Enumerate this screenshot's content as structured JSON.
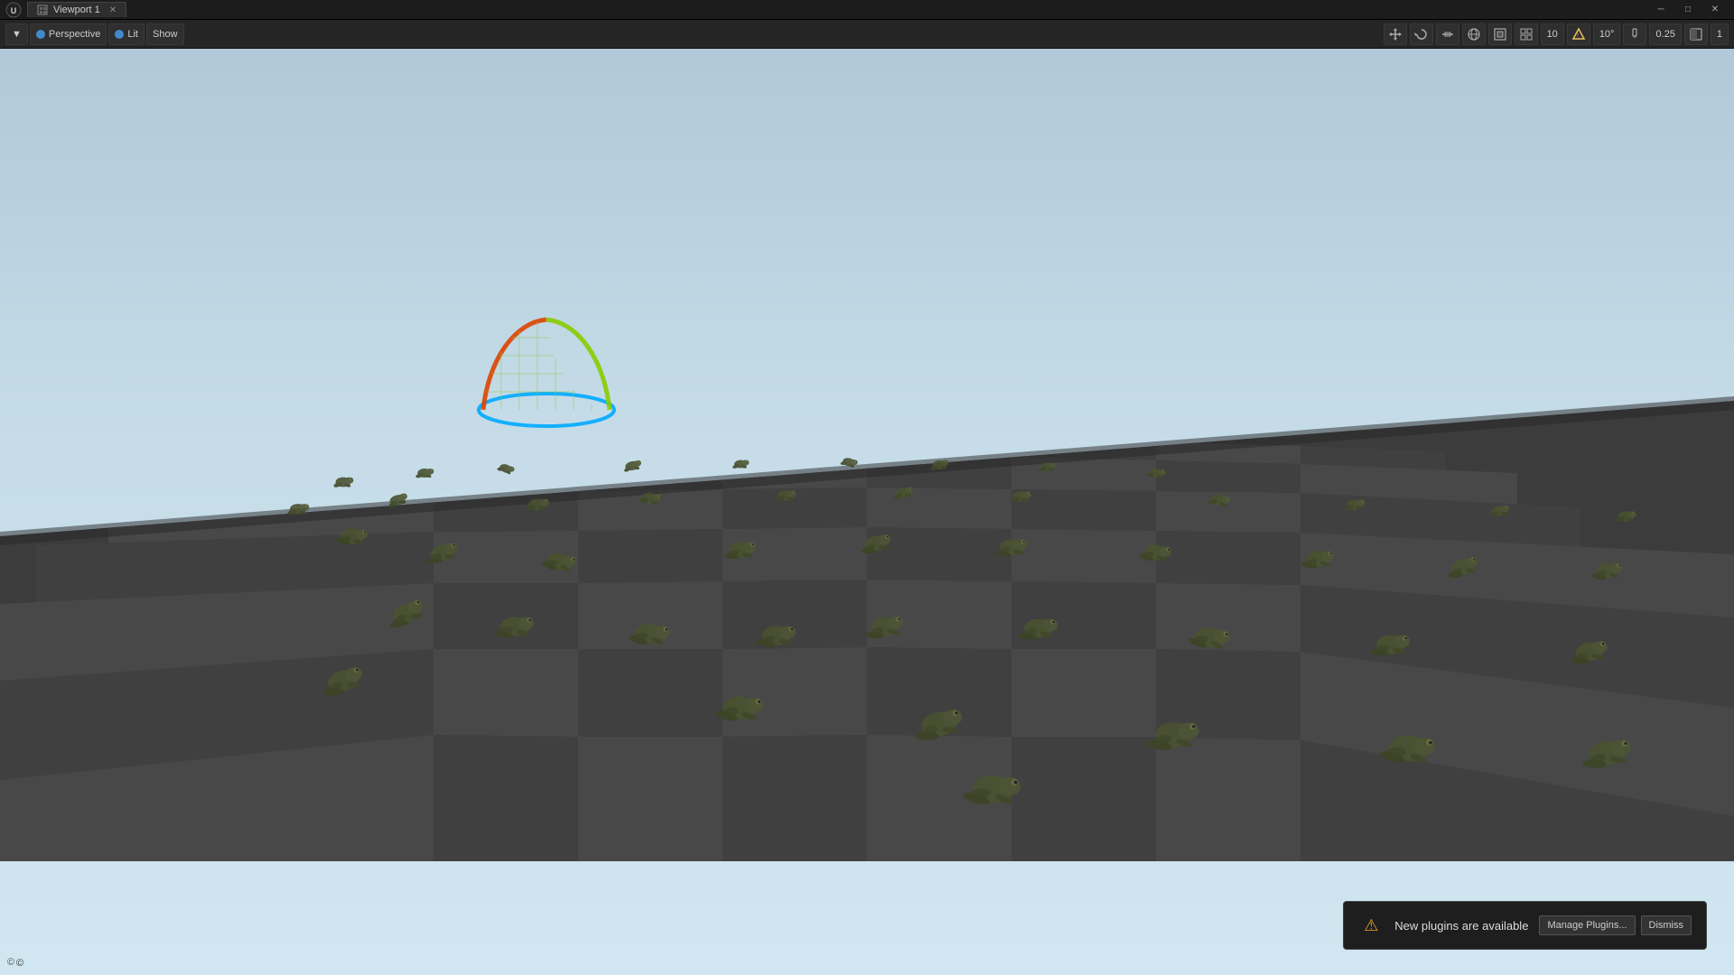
{
  "titleBar": {
    "logo": "UE",
    "tab": {
      "icon": "viewport-icon",
      "label": "Viewport 1"
    },
    "windowControls": {
      "minimize": "─",
      "maximize": "□",
      "close": "✕"
    }
  },
  "toolbar": {
    "viewportMenu": {
      "icon": "chevron-down",
      "label": "▼"
    },
    "perspectiveBtn": {
      "dot": "blue",
      "label": "Perspective"
    },
    "litBtn": {
      "dot": "blue",
      "label": "Lit"
    },
    "showBtn": {
      "label": "Show"
    }
  },
  "rightToolbar": {
    "icons": [
      {
        "name": "translate-icon",
        "symbol": "⊕"
      },
      {
        "name": "rotate-icon",
        "symbol": "↻"
      },
      {
        "name": "scale-icon",
        "symbol": "⇔"
      },
      {
        "name": "world-icon",
        "symbol": "🌐"
      },
      {
        "name": "surface-icon",
        "symbol": "⊞"
      },
      {
        "name": "grid-icon",
        "symbol": "⊟"
      }
    ],
    "gridValue": "10",
    "angleIcon": "△",
    "angleValue": "10°",
    "brushIcon": "🖊",
    "brushValue": "0.25",
    "layerIcon": "◧",
    "layerValue": "1"
  },
  "notification": {
    "icon": "⚠",
    "text": "New plugins are available",
    "buttons": [
      {
        "name": "manage-plugins-btn",
        "label": "Manage Plugins..."
      },
      {
        "name": "dismiss-btn",
        "label": "Dismiss"
      }
    ]
  },
  "viewport": {
    "mode": "Perspective",
    "lit": "Lit",
    "show": "Show"
  }
}
